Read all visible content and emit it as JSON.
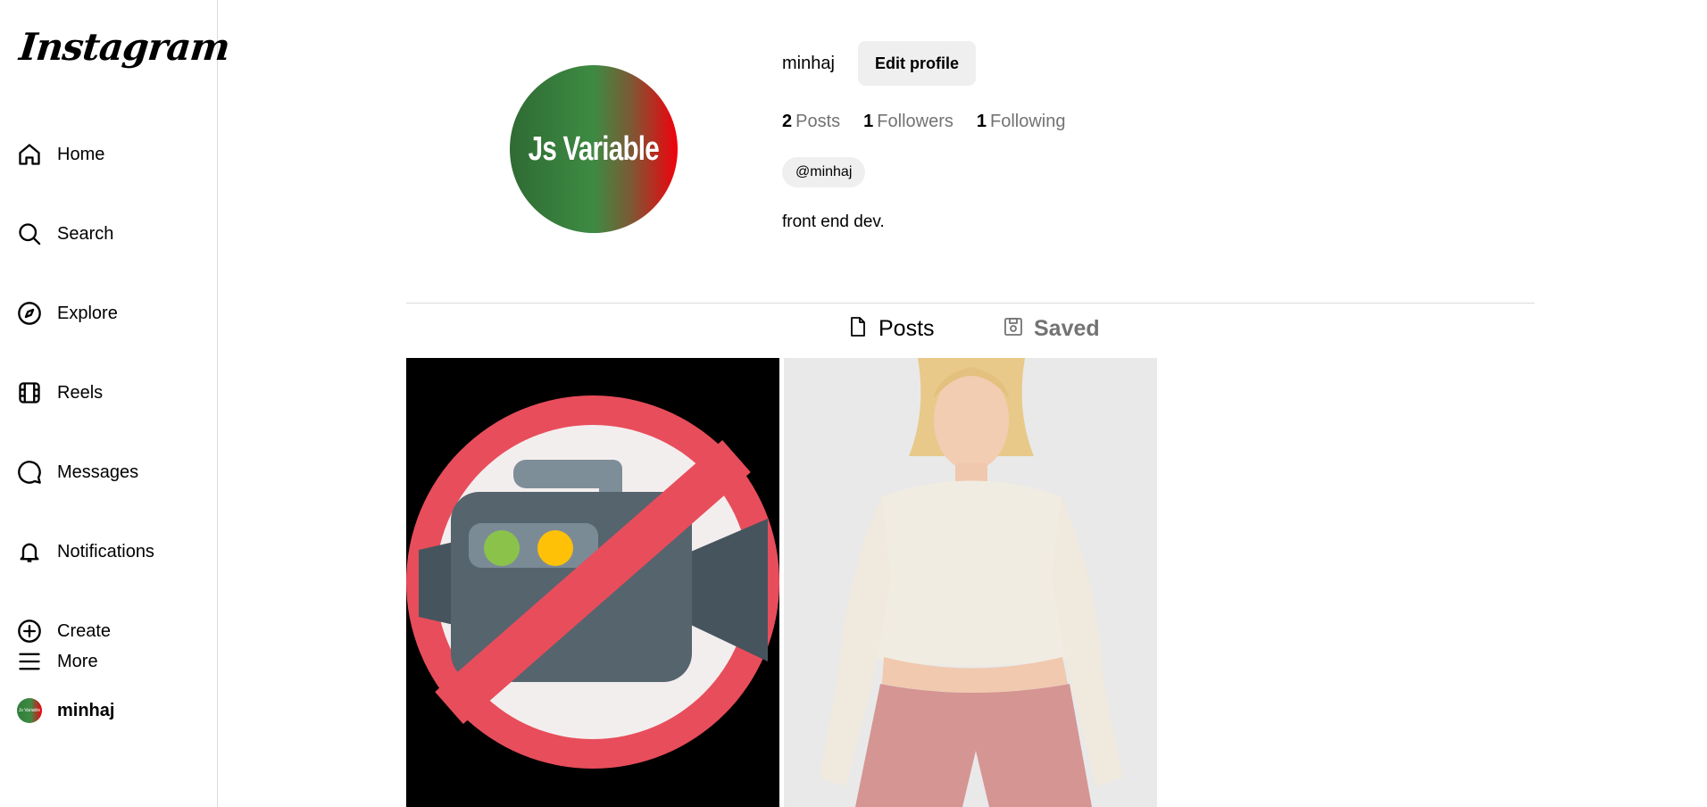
{
  "app": {
    "logo": "Instagram"
  },
  "sidebar": {
    "items": [
      {
        "label": "Home",
        "icon": "home-icon"
      },
      {
        "label": "Search",
        "icon": "search-icon"
      },
      {
        "label": "Explore",
        "icon": "compass-icon"
      },
      {
        "label": "Reels",
        "icon": "reels-icon"
      },
      {
        "label": "Messages",
        "icon": "message-icon"
      },
      {
        "label": "Notifications",
        "icon": "bell-icon"
      },
      {
        "label": "Create",
        "icon": "plus-circle-icon"
      },
      {
        "label": "minhaj",
        "icon": "avatar"
      }
    ],
    "more_label": "More"
  },
  "profile": {
    "username": "minhaj",
    "edit_label": "Edit profile",
    "avatar_text": "Js Variable",
    "mini_avatar_text": "Js Variable",
    "stats": {
      "posts_count": "2",
      "posts_label": "Posts",
      "followers_count": "1",
      "followers_label": "Followers",
      "following_count": "1",
      "following_label": "Following"
    },
    "handle": "@minhaj",
    "bio": "front end dev."
  },
  "tabs": [
    {
      "label": "Posts",
      "icon": "file-icon",
      "active": true
    },
    {
      "label": "Saved",
      "icon": "save-icon",
      "active": false
    }
  ],
  "posts": [
    {
      "image": "no-video-camera-sign"
    },
    {
      "image": "woman-in-cream-top-and-pink-leggings"
    }
  ],
  "colors": {
    "divider": "#dbdbdb",
    "button_bg": "#efefef",
    "muted_text": "#737373",
    "avatar_green": "#3d8b43",
    "avatar_red": "#f2000c"
  }
}
